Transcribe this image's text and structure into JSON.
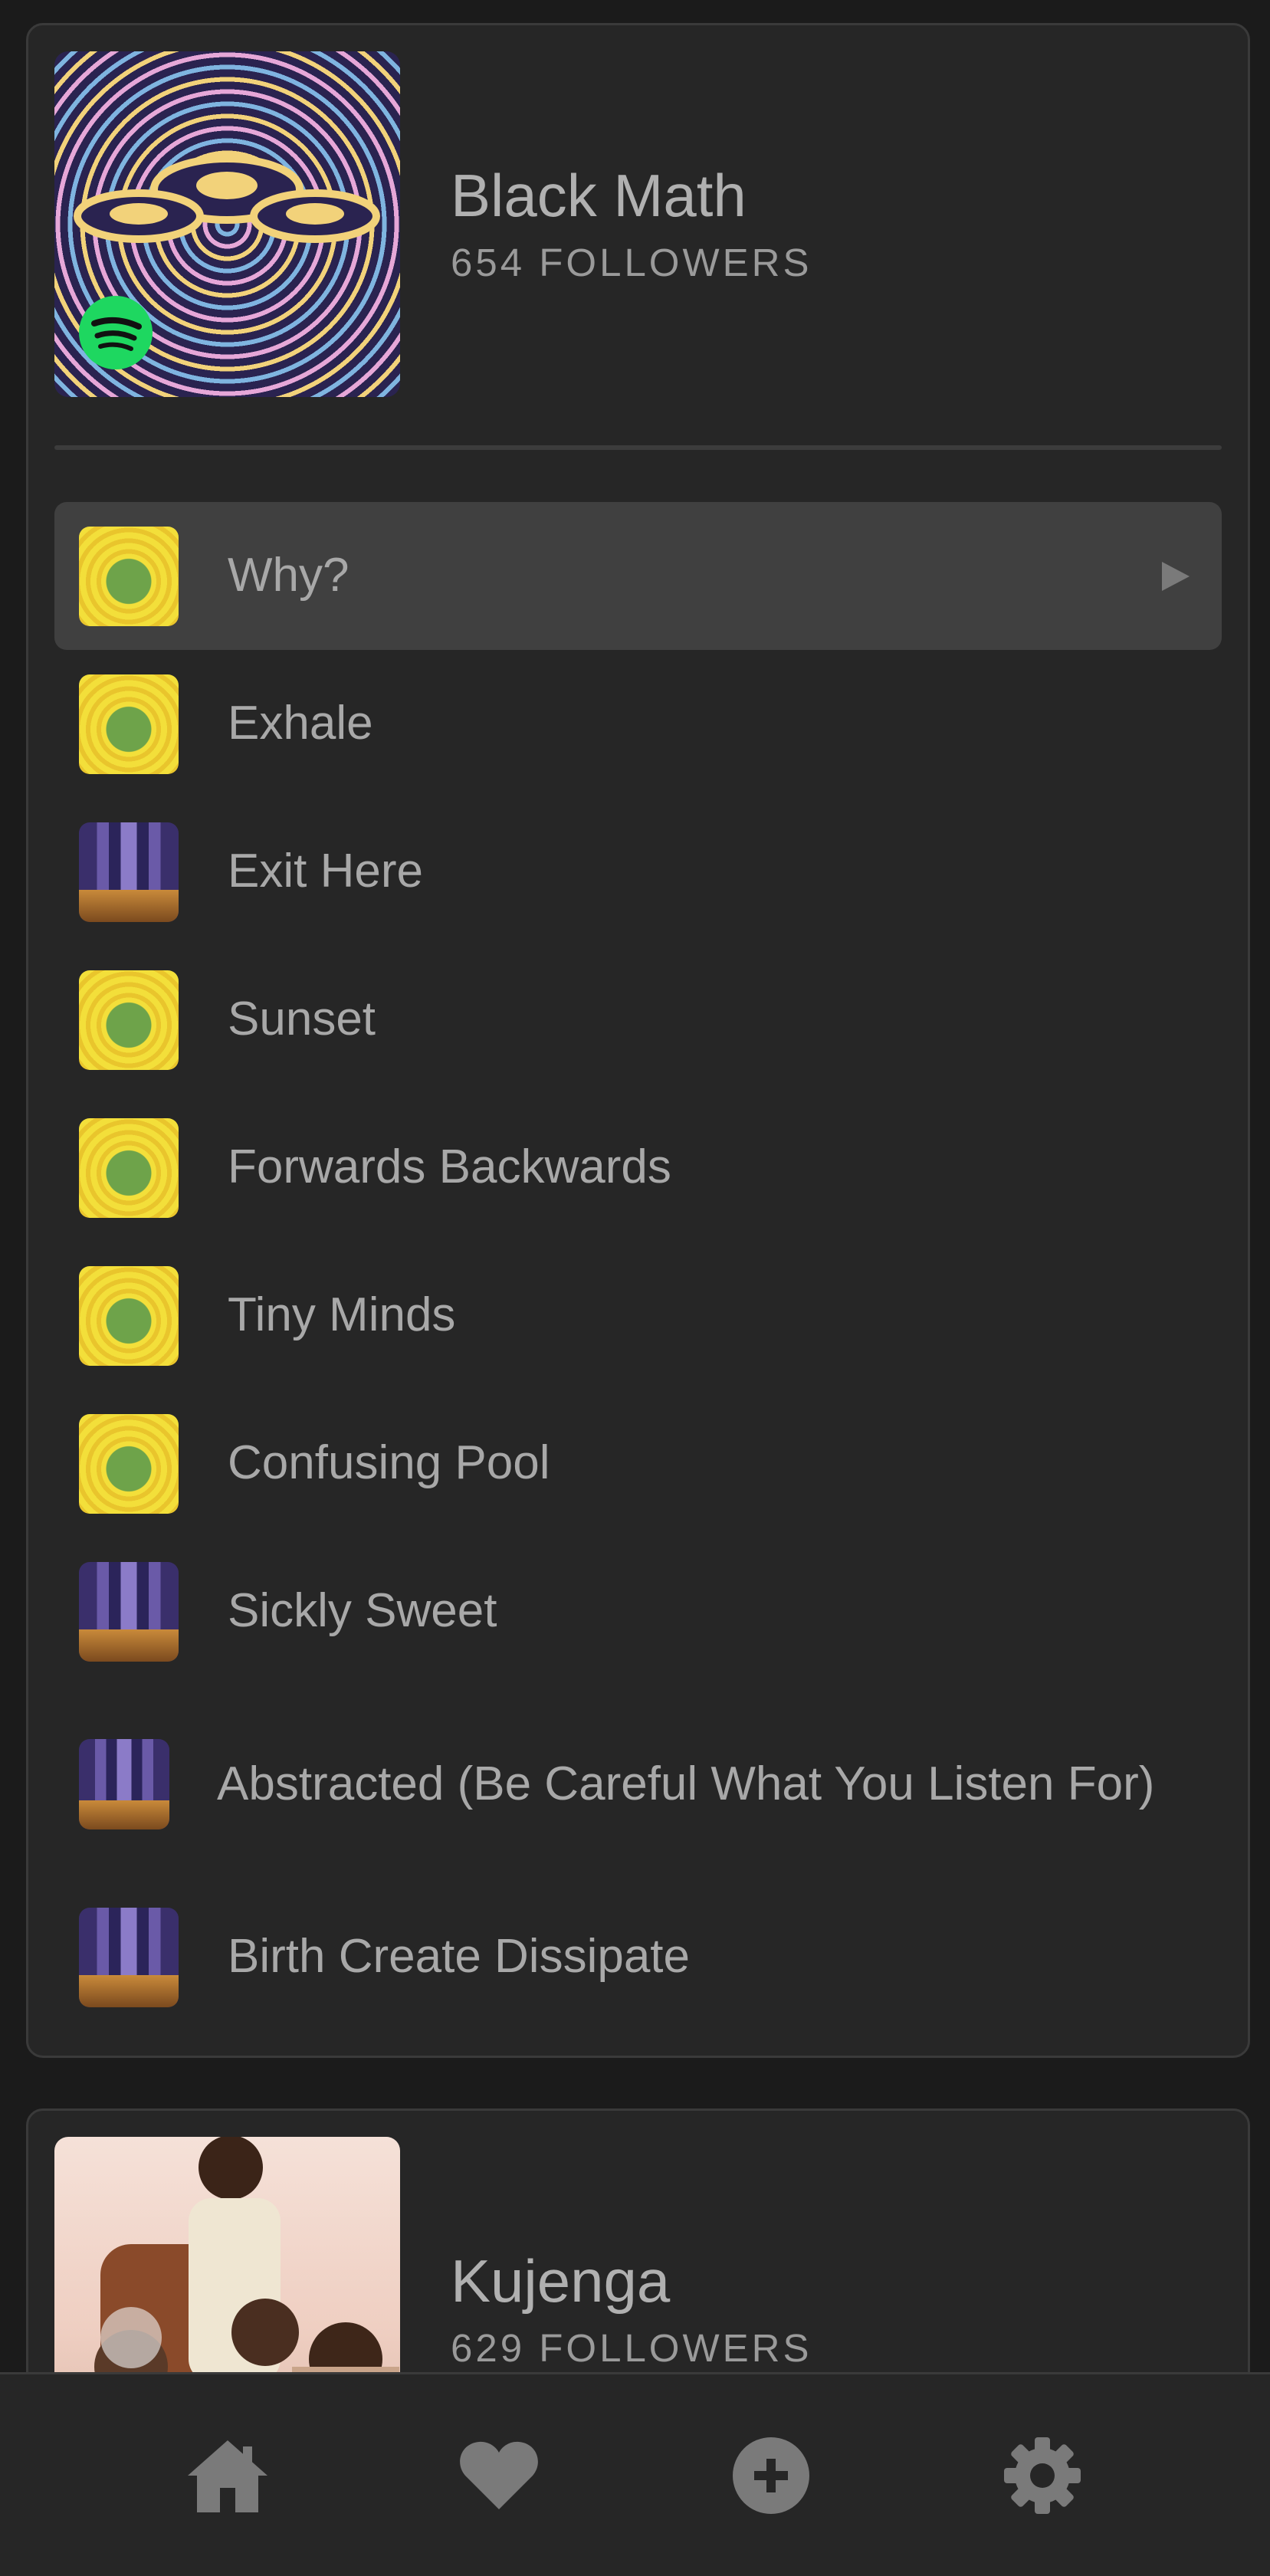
{
  "artists": [
    {
      "name": "Black Math",
      "followers": "654 FOLLOWERS",
      "art_icon": "eye-pattern-art",
      "badge_icon": "spotify-icon",
      "tracks": [
        {
          "title": "Why?",
          "art": "yellow-monster",
          "active": true
        },
        {
          "title": "Exhale",
          "art": "yellow-monster"
        },
        {
          "title": "Exit Here",
          "art": "city-street"
        },
        {
          "title": "Sunset",
          "art": "yellow-monster"
        },
        {
          "title": "Forwards Backwards",
          "art": "yellow-monster"
        },
        {
          "title": "Tiny Minds",
          "art": "yellow-monster"
        },
        {
          "title": "Confusing Pool",
          "art": "yellow-monster"
        },
        {
          "title": "Sickly Sweet",
          "art": "city-street"
        },
        {
          "title": "Abstracted (Be Careful What You Listen For)",
          "art": "city-street"
        },
        {
          "title": "Birth Create Dissipate",
          "art": "city-street"
        }
      ]
    },
    {
      "name": "Kujenga",
      "followers": "629 FOLLOWERS",
      "art_icon": "group-photo"
    }
  ],
  "bottom_nav": [
    {
      "icon": "home-icon"
    },
    {
      "icon": "heart-icon"
    },
    {
      "icon": "add-circle-icon"
    },
    {
      "icon": "gear-icon"
    }
  ],
  "colors": {
    "background": "#1b1b1b",
    "card": "#262626",
    "active_row": "#404040",
    "text_primary": "#b0b0b0",
    "spotify_green": "#1ed760"
  }
}
